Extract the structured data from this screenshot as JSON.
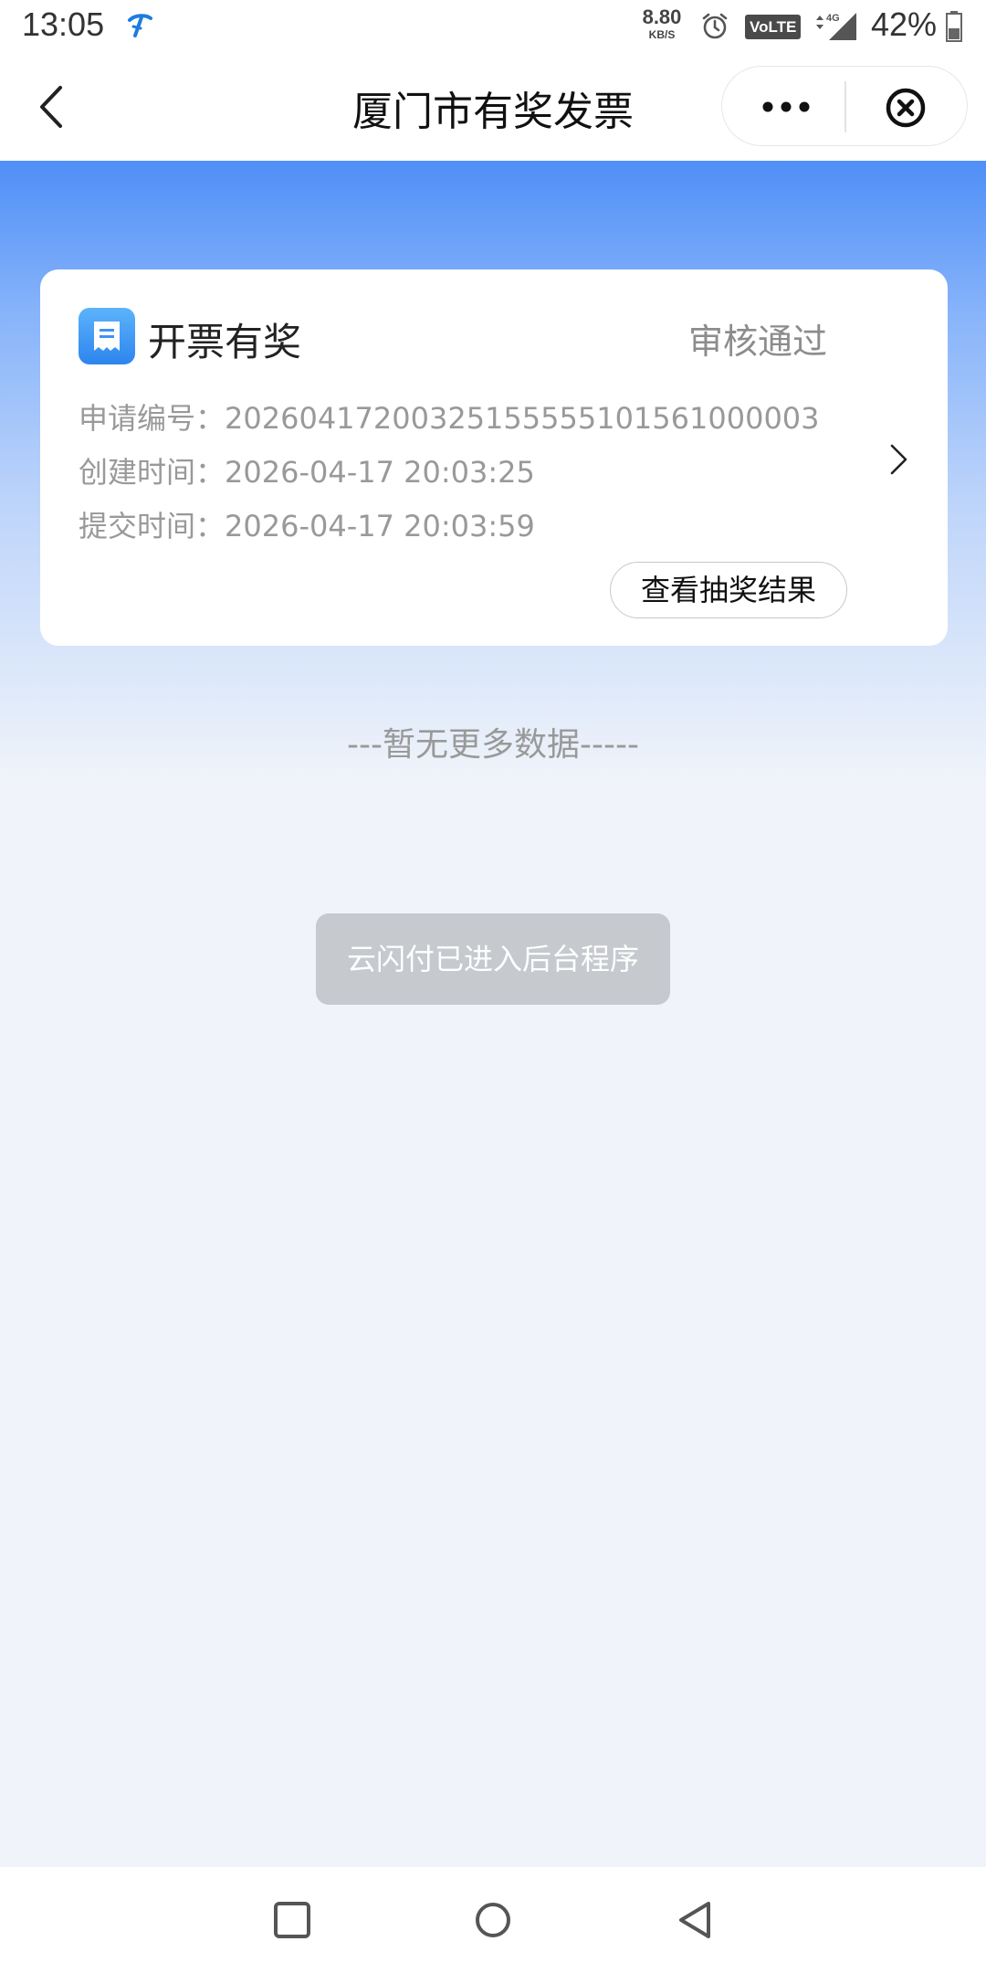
{
  "status_bar": {
    "time": "13:05",
    "net_speed_value": "8.80",
    "net_speed_unit": "KB/S",
    "volte_label": "VoLTE",
    "network_type": "4G",
    "battery_percent": "42%",
    "icons": [
      "carrier-icon",
      "alarm-icon",
      "volte-icon",
      "signal-icon",
      "battery-icon"
    ]
  },
  "nav_bar": {
    "title": "厦门市有奖发票",
    "icons": [
      "back-icon",
      "more-icon",
      "close-icon"
    ]
  },
  "card": {
    "title": "开票有奖",
    "status": "审核通过",
    "fields": [
      {
        "label": "申请编号：",
        "value": "20260417200325155555101561000003"
      },
      {
        "label": "创建时间：",
        "value": "2026-04-17 20:03:25"
      },
      {
        "label": "提交时间：",
        "value": "2026-04-17 20:03:59"
      }
    ],
    "action_label": "查看抽奖结果",
    "icon": "receipt-icon",
    "arrow_icon": "chevron-right-icon"
  },
  "list_footer": "---暂无更多数据-----",
  "toast": "云闪付已进入后台程序",
  "system_nav": {
    "icons": [
      "recent-apps-icon",
      "home-icon",
      "back-triangle-icon"
    ]
  },
  "colors": {
    "header_gradient_top": "#4f8ff7",
    "page_background": "#f0f4fa",
    "icon_blue": "#2d85ee",
    "toast_background": "#c6c9ce"
  }
}
